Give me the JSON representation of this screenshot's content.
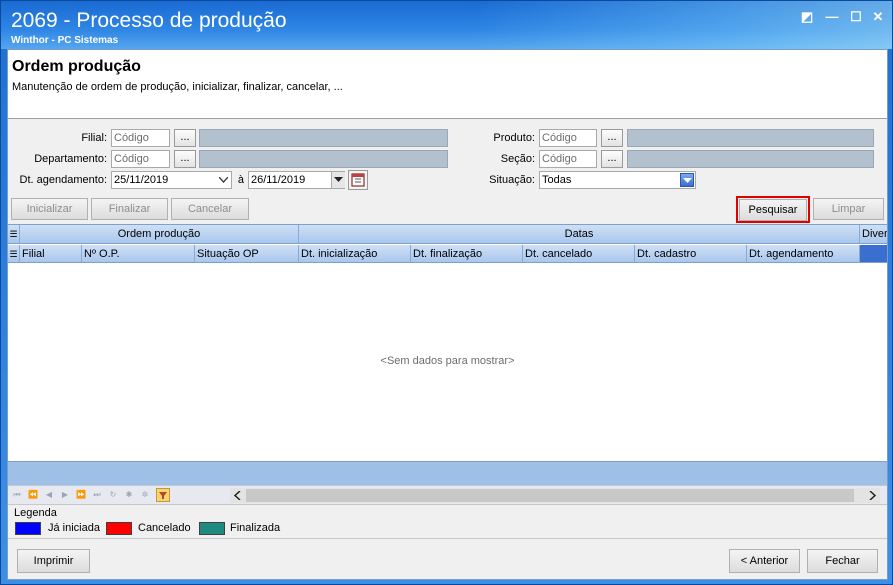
{
  "window": {
    "title": "2069 - Processo de produção",
    "subtitle": "Winthor - PC Sistemas",
    "controls": {
      "restore": "◩",
      "minimize": "—",
      "maximize": "☐",
      "close": "✕"
    }
  },
  "header": {
    "title": "Ordem produção",
    "description": "Manutenção de ordem de produção, inicializar, finalizar, cancelar, ..."
  },
  "filters": {
    "filial": {
      "label": "Filial:",
      "placeholder": "Código",
      "button": "..."
    },
    "departamento": {
      "label": "Departamento:",
      "placeholder": "Código",
      "button": "..."
    },
    "agendamento": {
      "label": "Dt. agendamento:",
      "from": "25/11/2019",
      "separator": "à",
      "to": "26/11/2019"
    },
    "produto": {
      "label": "Produto:",
      "placeholder": "Código",
      "button": "..."
    },
    "secao": {
      "label": "Seção:",
      "placeholder": "Código",
      "button": "..."
    },
    "situacao": {
      "label": "Situação:",
      "value": "Todas"
    }
  },
  "actions": {
    "inicializar": "Inicializar",
    "finalizar": "Finalizar",
    "cancelar": "Cancelar",
    "pesquisar": "Pesquisar",
    "limpar": "Limpar"
  },
  "grid": {
    "groups": [
      "Ordem produção",
      "Datas",
      "Diver"
    ],
    "columns": [
      "Filial",
      "Nº O.P.",
      "Situação OP",
      "Dt. inicialização",
      "Dt. finalização",
      "Dt. cancelado",
      "Dt. cadastro",
      "Dt. agendamento"
    ],
    "empty_text": "<Sem dados para mostrar>"
  },
  "legend": {
    "title": "Legenda",
    "items": [
      {
        "label": "Já iniciada",
        "color": "#0000ff"
      },
      {
        "label": "Cancelado",
        "color": "#ff0000"
      },
      {
        "label": "Finalizada",
        "color": "#1f8a80"
      }
    ]
  },
  "footer": {
    "imprimir": "Imprimir",
    "anterior": "< Anterior",
    "fechar": "Fechar"
  },
  "colors": {
    "title_bar": "#2f86e4",
    "highlight_border": "#e00000",
    "readonly_field": "#b3c0ce",
    "grid_header": "#a9c7ee"
  }
}
